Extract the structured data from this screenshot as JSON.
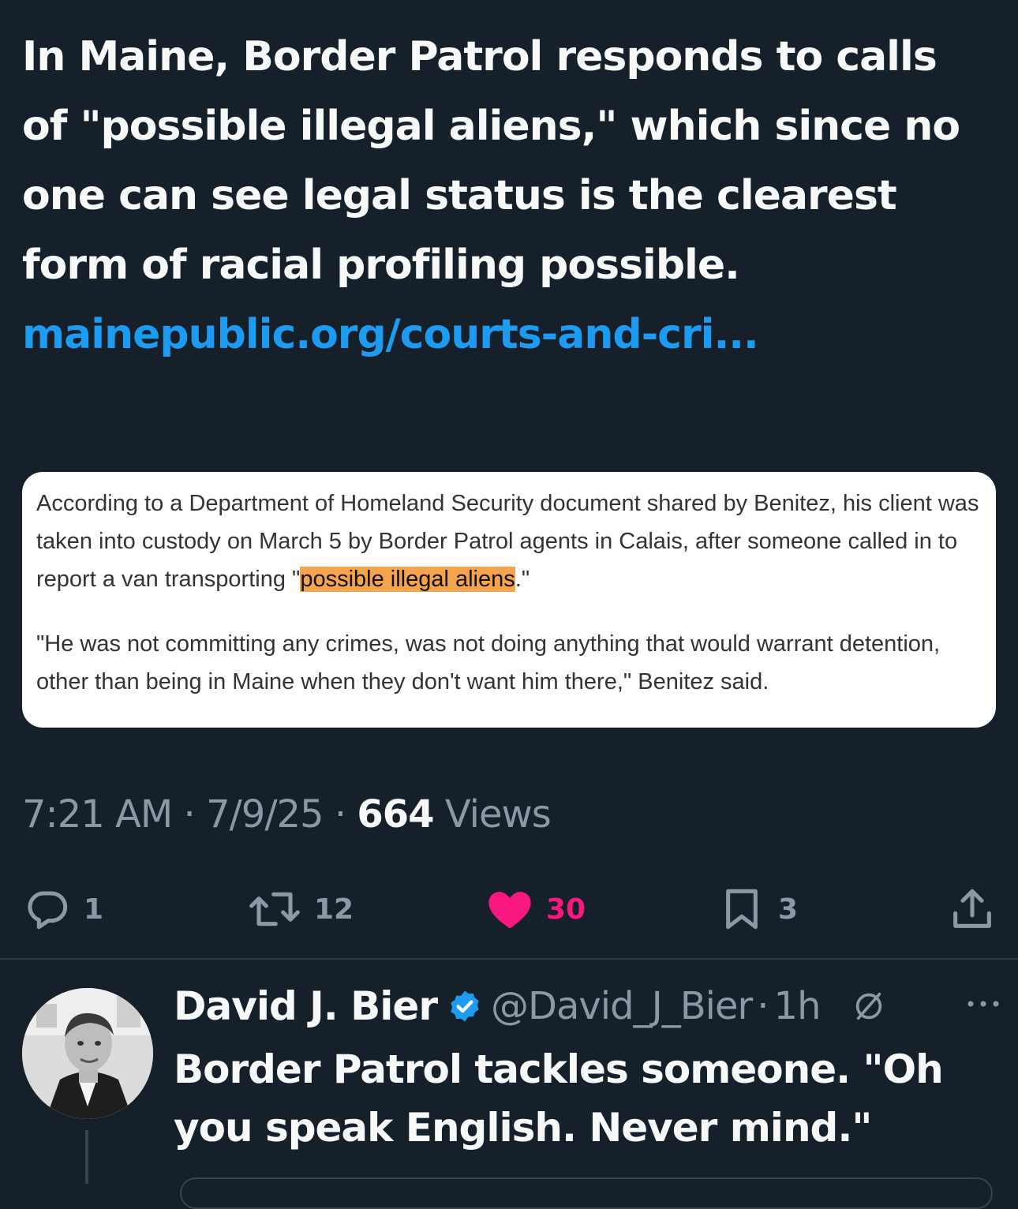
{
  "tweet": {
    "text_before_link": "In Maine, Border Patrol responds to calls of \"possible illegal aliens,\" which since no one can see legal status is the clearest form of racial profiling possible. ",
    "link_text": "mainepublic.org/courts-and-cri..."
  },
  "quote_card": {
    "paragraph1_before": "According to a Department of Homeland Security document shared by Benitez, his client was taken into custody on March 5 by Border Patrol agents in Calais, after someone called in to report a van transporting \"",
    "paragraph1_highlight": "possible illegal aliens",
    "paragraph1_after": ".\"",
    "paragraph2": "\"He was not committing any crimes, was not doing anything that would warrant detention, other than being in Maine when they don't want him there,\" Benitez said."
  },
  "meta": {
    "time": "7:21 AM",
    "sep1": " · ",
    "date": "7/9/25",
    "sep2": " · ",
    "views_count": "664",
    "views_label": " Views"
  },
  "actions": {
    "reply_count": "1",
    "retweet_count": "12",
    "like_count": "30",
    "bookmark_count": "3",
    "icons": [
      "reply-icon",
      "retweet-icon",
      "heart-icon",
      "bookmark-icon",
      "share-icon"
    ],
    "like_color": "#f91880"
  },
  "reply": {
    "author_name": "David J. Bier",
    "handle": "@David_J_Bier",
    "separator": "·",
    "time": "1h",
    "text": "Border Patrol tackles someone. \"Oh you speak English. Never mind.\""
  },
  "colors": {
    "background": "#15202b",
    "link": "#1d9bf0",
    "secondary_text": "#8b98a5",
    "highlight": "#f4a44c"
  }
}
